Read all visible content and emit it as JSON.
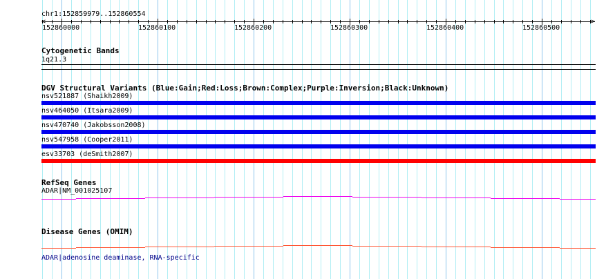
{
  "location": "chr1:152859979..152860554",
  "ruler": {
    "range": [
      152859979,
      152860554
    ],
    "labels": [
      "152860000",
      "152860100",
      "152860200",
      "152860300",
      "152860400",
      "152860500"
    ]
  },
  "tracks": {
    "cytoband": {
      "title": "Cytogenetic Bands",
      "band": "1q21.3"
    },
    "dgv": {
      "title": "DGV Structural Variants (Blue:Gain;Red:Loss;Brown:Complex;Purple:Inversion;Black:Unknown)",
      "items": [
        {
          "label": "nsv521887 (Shaikh2009)",
          "color": "#0000ee"
        },
        {
          "label": "nsv464050 (Itsara2009)",
          "color": "#0000ee"
        },
        {
          "label": "nsv470740 (Jakobsson2008)",
          "color": "#0000ee"
        },
        {
          "label": "nsv547958 (Cooper2011)",
          "color": "#0000ee"
        },
        {
          "label": "esv33703 (deSmith2007)",
          "color": "#ff0000"
        }
      ]
    },
    "refseq": {
      "title": "RefSeq Genes",
      "gene": "ADAR|NM_001025107",
      "color": "#ee00ee"
    },
    "omim": {
      "title": "Disease Genes (OMIM)",
      "gene": "ADAR|adenosine deaminase, RNA-specific",
      "color": "#ff5533",
      "label_color": "#000088"
    }
  }
}
